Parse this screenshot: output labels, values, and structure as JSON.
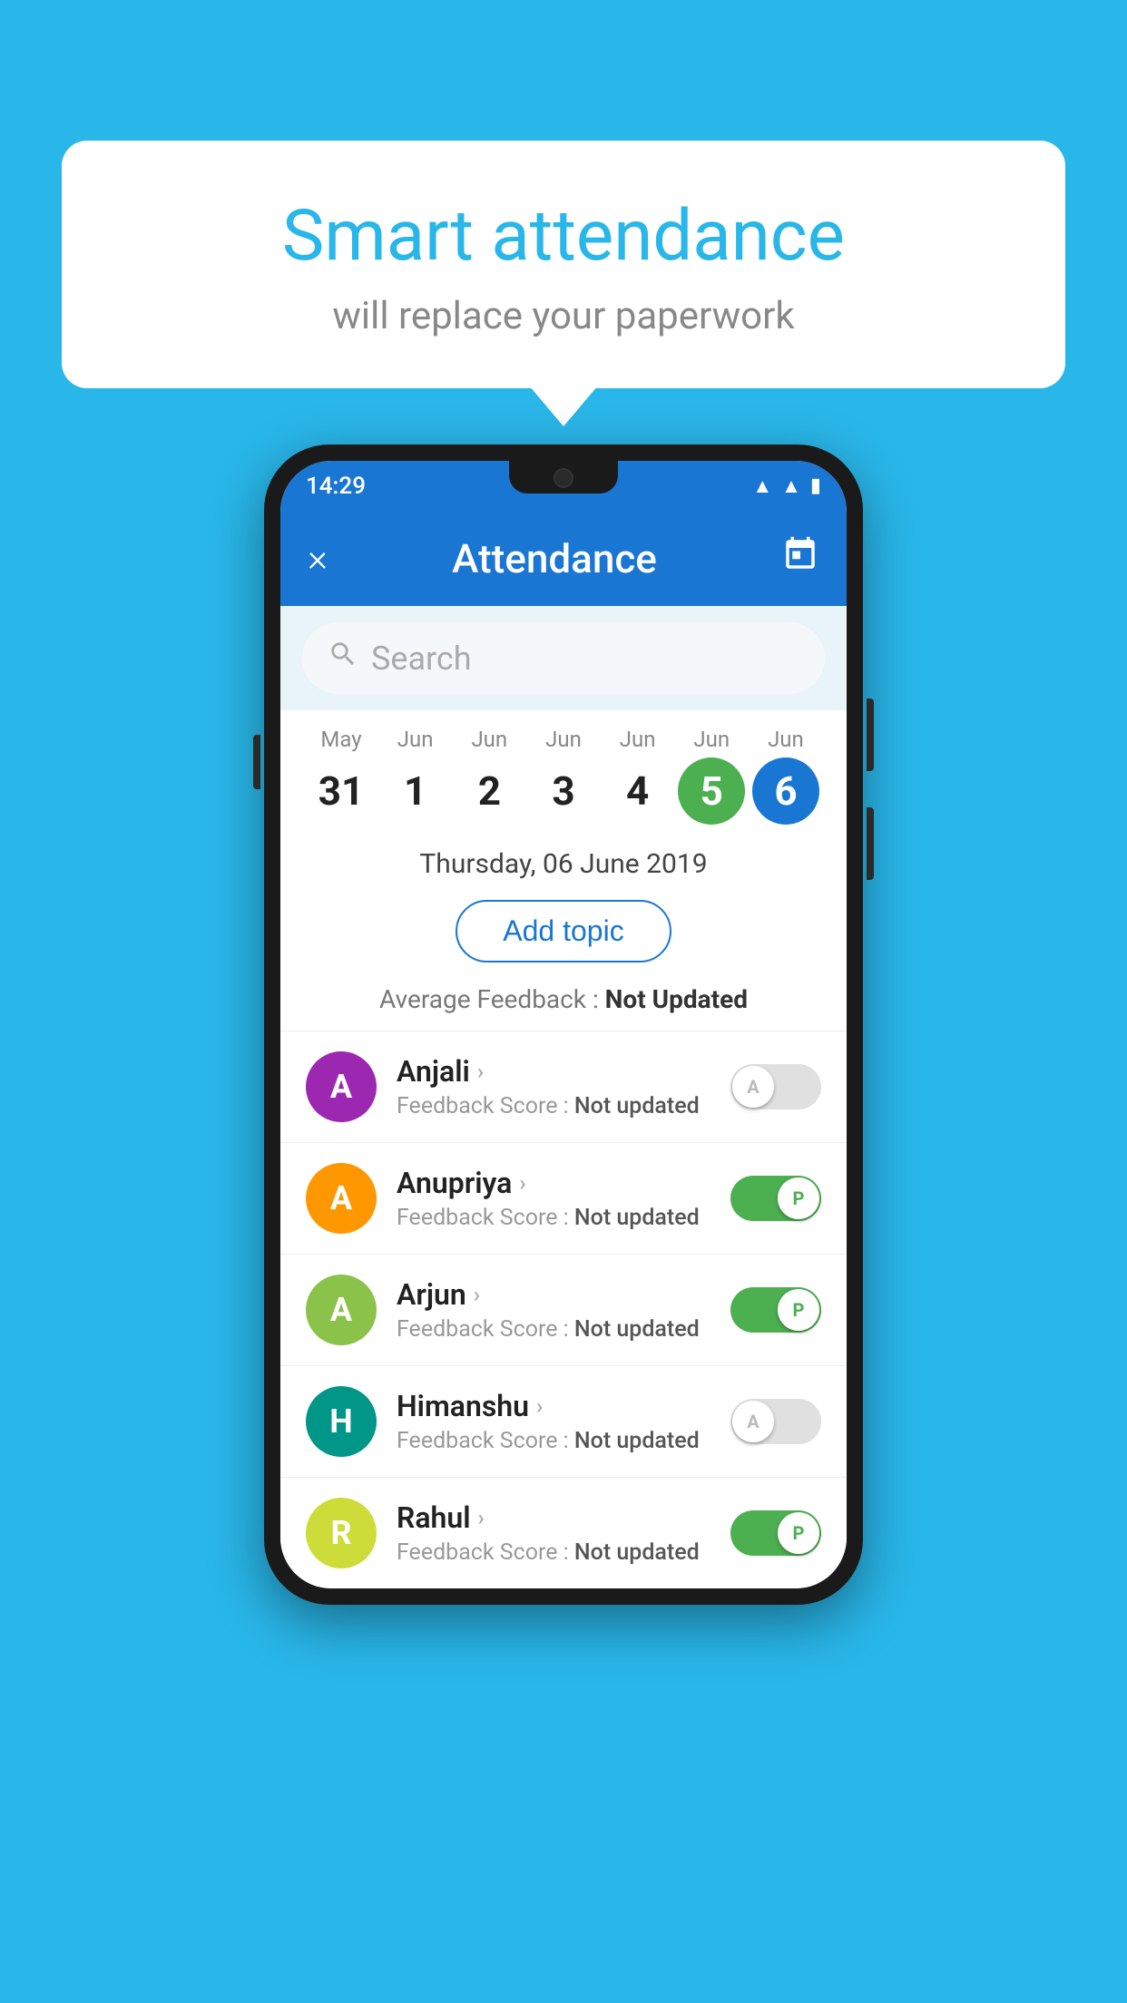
{
  "background_color": "#29b6e8",
  "speech_bubble": {
    "title": "Smart attendance",
    "subtitle": "will replace your paperwork"
  },
  "status_bar": {
    "time": "14:29",
    "icons": [
      "wifi",
      "signal",
      "battery"
    ]
  },
  "app_bar": {
    "title": "Attendance",
    "close_label": "×",
    "calendar_label": "📅"
  },
  "search": {
    "placeholder": "Search"
  },
  "calendar": {
    "days": [
      {
        "month": "May",
        "date": "31",
        "state": "normal"
      },
      {
        "month": "Jun",
        "date": "1",
        "state": "normal"
      },
      {
        "month": "Jun",
        "date": "2",
        "state": "normal"
      },
      {
        "month": "Jun",
        "date": "3",
        "state": "normal"
      },
      {
        "month": "Jun",
        "date": "4",
        "state": "normal"
      },
      {
        "month": "Jun",
        "date": "5",
        "state": "today"
      },
      {
        "month": "Jun",
        "date": "6",
        "state": "selected"
      }
    ]
  },
  "selected_date": "Thursday, 06 June 2019",
  "add_topic_label": "Add topic",
  "avg_feedback_label": "Average Feedback : ",
  "avg_feedback_value": "Not Updated",
  "students": [
    {
      "name": "Anjali",
      "initial": "A",
      "avatar_color": "purple",
      "score_label": "Feedback Score : ",
      "score_value": "Not updated",
      "toggle_state": "off",
      "toggle_label": "A"
    },
    {
      "name": "Anupriya",
      "initial": "A",
      "avatar_color": "orange",
      "score_label": "Feedback Score : ",
      "score_value": "Not updated",
      "toggle_state": "on",
      "toggle_label": "P"
    },
    {
      "name": "Arjun",
      "initial": "A",
      "avatar_color": "green",
      "score_label": "Feedback Score : ",
      "score_value": "Not updated",
      "toggle_state": "on",
      "toggle_label": "P"
    },
    {
      "name": "Himanshu",
      "initial": "H",
      "avatar_color": "teal",
      "score_label": "Feedback Score : ",
      "score_value": "Not updated",
      "toggle_state": "off",
      "toggle_label": "A"
    },
    {
      "name": "Rahul",
      "initial": "R",
      "avatar_color": "light-green",
      "score_label": "Feedback Score : ",
      "score_value": "Not updated",
      "toggle_state": "on",
      "toggle_label": "P"
    }
  ]
}
